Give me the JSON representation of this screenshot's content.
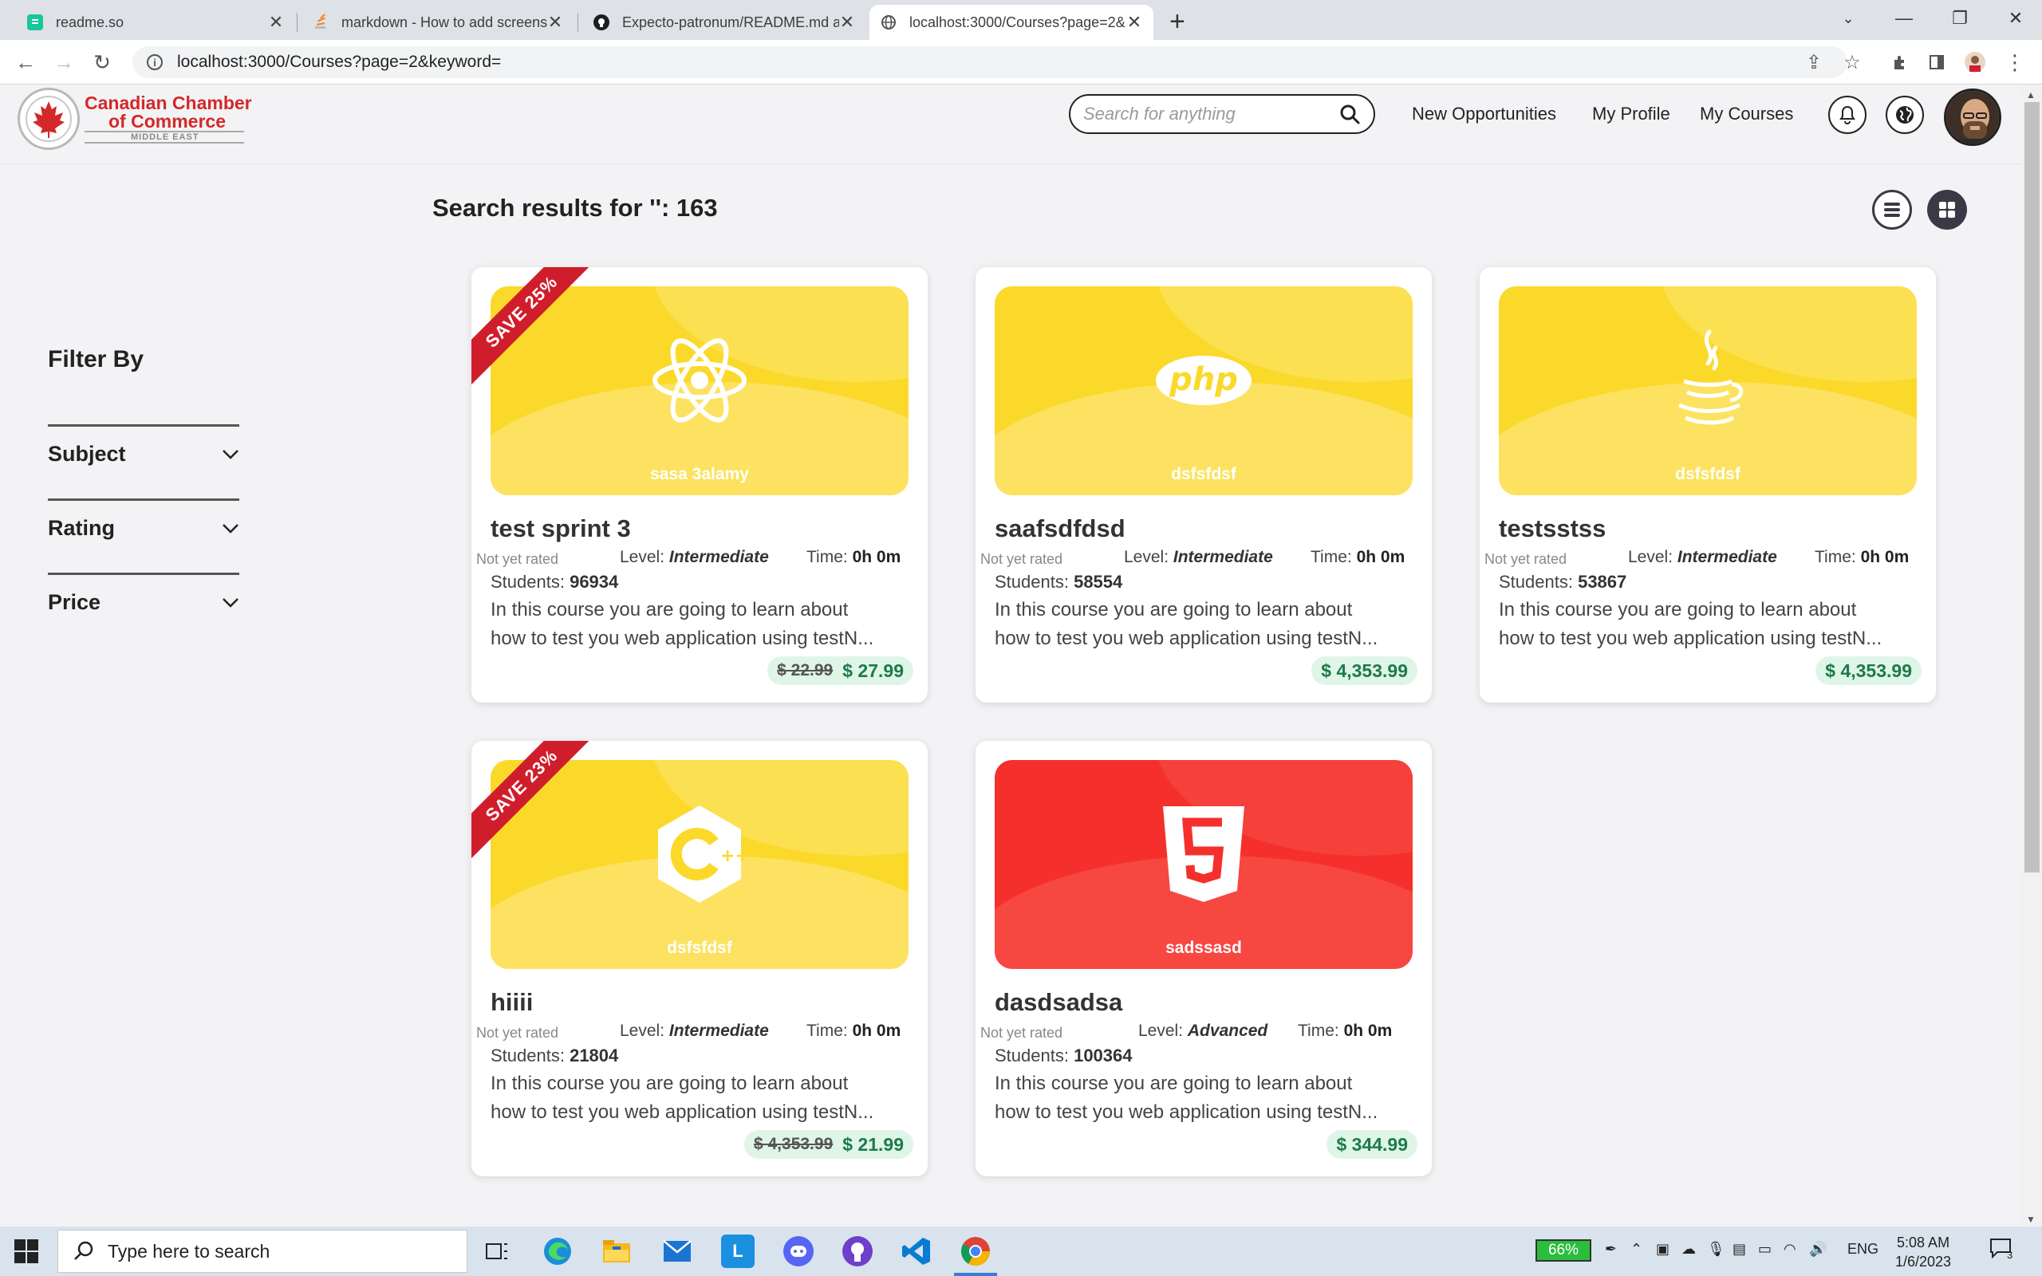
{
  "browser": {
    "tabs": [
      {
        "title": "readme.so",
        "icon": "readme-favicon"
      },
      {
        "title": "markdown - How to add screensho",
        "icon": "stackoverflow-favicon"
      },
      {
        "title": "Expecto-patronum/README.md at",
        "icon": "github-favicon"
      },
      {
        "title": "localhost:3000/Courses?page=2&",
        "icon": "globe-favicon"
      }
    ],
    "url": "localhost:3000/Courses?page=2&keyword="
  },
  "header": {
    "logo": {
      "line1": "Canadian Chamber",
      "line2": "of Commerce",
      "line3": "MIDDLE EAST",
      "seal": "CanCham"
    },
    "search_placeholder": "Search for anything",
    "nav": [
      "New Opportunities",
      "My Profile",
      "My Courses"
    ]
  },
  "results_title": "Search results for '': 163",
  "filters": {
    "title": "Filter By",
    "items": [
      "Subject",
      "Rating",
      "Price"
    ]
  },
  "labels": {
    "not_rated": "Not yet rated",
    "level": "Level:",
    "time": "Time:",
    "students": "Students:"
  },
  "courses": [
    {
      "title": "test sprint 3",
      "author": "sasa 3alamy",
      "level": "Intermediate",
      "time": "0h 0m",
      "students": "96934",
      "desc_line1": "In this course you are going to learn about",
      "desc_line2": "how to test you web application using testN...",
      "old_price": "$ 22.99",
      "price": "$ 27.99",
      "ribbon": "SAVE 25%",
      "icon": "react-icon",
      "color": "#fbd92b"
    },
    {
      "title": "saafsdfdsd",
      "author": "dsfsfdsf",
      "level": "Intermediate",
      "time": "0h 0m",
      "students": "58554",
      "desc_line1": "In this course you are going to learn about",
      "desc_line2": "how to test you web application using testN...",
      "price": "$ 4,353.99",
      "icon": "php-icon",
      "color": "#fbd92b"
    },
    {
      "title": "testsstss",
      "author": "dsfsfdsf",
      "level": "Intermediate",
      "time": "0h 0m",
      "students": "53867",
      "desc_line1": "In this course you are going to learn about",
      "desc_line2": "how to test you web application using testN...",
      "price": "$ 4,353.99",
      "icon": "java-icon",
      "color": "#fbd92b"
    },
    {
      "title": "hiiii",
      "author": "dsfsfdsf",
      "level": "Intermediate",
      "time": "0h 0m",
      "students": "21804",
      "desc_line1": "In this course you are going to learn about",
      "desc_line2": "how to test you web application using testN...",
      "old_price": "$ 4,353.99",
      "price": "$ 21.99",
      "ribbon": "SAVE 23%",
      "icon": "cpp-icon",
      "color": "#fbd92b"
    },
    {
      "title": "dasdsadsa",
      "author": "sadssasd",
      "level": "Advanced",
      "time": "0h 0m",
      "students": "100364",
      "desc_line1": "In this course you are going to learn about",
      "desc_line2": "how to test you web application using testN...",
      "price": "$ 344.99",
      "icon": "html5-icon",
      "color": "#f5302c"
    }
  ],
  "taskbar": {
    "search_placeholder": "Type here to search",
    "battery": "66%",
    "lang": "ENG",
    "time": "5:08 AM",
    "date": "1/6/2023",
    "notifications": "3"
  }
}
